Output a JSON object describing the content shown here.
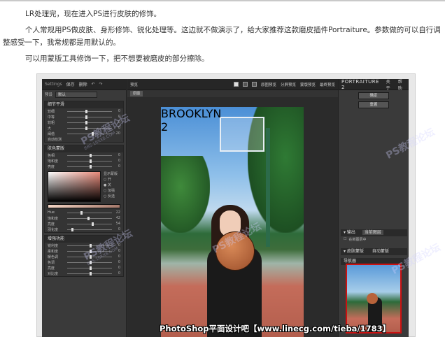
{
  "article": {
    "p1": "LR处理完，现在进入PS进行皮肤的修饰。",
    "p2": "个人常规用PS做皮肤、身形修饰、锐化处理等。这边就不做演示了，给大家推荐这款磨皮插件Portraiture。参数做的可以自行调",
    "p2b": "整感受一下，我常规都是用默认的。",
    "p3": "可以用蒙版工具修饰一下，把不想要被磨皮的部分擦除。"
  },
  "app": {
    "left": {
      "settings_label": "Settings",
      "btn_save": "保存",
      "btn_delete": "删除",
      "preset_label": "预设",
      "preset_value": "默认",
      "sec1_title": "细节平滑",
      "sec1_rows": [
        {
          "label": "较细",
          "value": "0"
        },
        {
          "label": "中等",
          "value": "0"
        },
        {
          "label": "较粗",
          "value": "0"
        },
        {
          "label": "大",
          "value": "0"
        },
        {
          "label": "阈值",
          "value": "20"
        },
        {
          "label": "自动检测",
          "value": ""
        }
      ],
      "sec2_title": "肤色蒙版",
      "sec2_rows": [
        {
          "label": "色相",
          "value": "0"
        },
        {
          "label": "饱和度",
          "value": "0"
        },
        {
          "label": "亮度",
          "value": "0"
        }
      ],
      "color_opts": [
        "显示蒙版",
        "开",
        "关",
        "加强",
        "反选"
      ],
      "sec2b_rows": [
        {
          "label": "Hue",
          "value": "22"
        },
        {
          "label": "饱和度",
          "value": "42"
        },
        {
          "label": "亮度",
          "value": "54"
        },
        {
          "label": "羽化度",
          "value": "0"
        }
      ],
      "sec3_title": "增强功能",
      "sec3_rows": [
        {
          "label": "锐利度",
          "value": "0"
        },
        {
          "label": "柔和度",
          "value": "0"
        },
        {
          "label": "暖色调",
          "value": "0"
        },
        {
          "label": "色调",
          "value": "0"
        },
        {
          "label": "亮度",
          "value": "0"
        },
        {
          "label": "对比度",
          "value": "0"
        }
      ]
    },
    "center": {
      "preview_label": "预览",
      "opt_single": "原图预览",
      "opt_split": "分屏预览",
      "opt_mask": "蒙版预览",
      "opt_final": "最终预览",
      "tab_label": "原图"
    },
    "right": {
      "brand": "PORTRAITURE 2",
      "about": "关于",
      "help": "帮助",
      "ok": "确定",
      "cancel": "重置",
      "output_title": "输出",
      "output_value": "当前图层",
      "output_check": "在新图层中",
      "mask_title": "皮肤蒙版",
      "mask_action": "自动蒙版",
      "nav_title": "导航器"
    }
  },
  "overlay": {
    "watermark_main": "PS教程论坛",
    "watermark_sub": "BBS.16XX8.COM",
    "caption": "PhotoShop平面设计吧【www.linecg.com/tieba/1783】"
  },
  "colors": {
    "window_bg": "#2f2f2f",
    "panel_bg": "#3a3a3a",
    "accent_red": "#cc1111"
  }
}
